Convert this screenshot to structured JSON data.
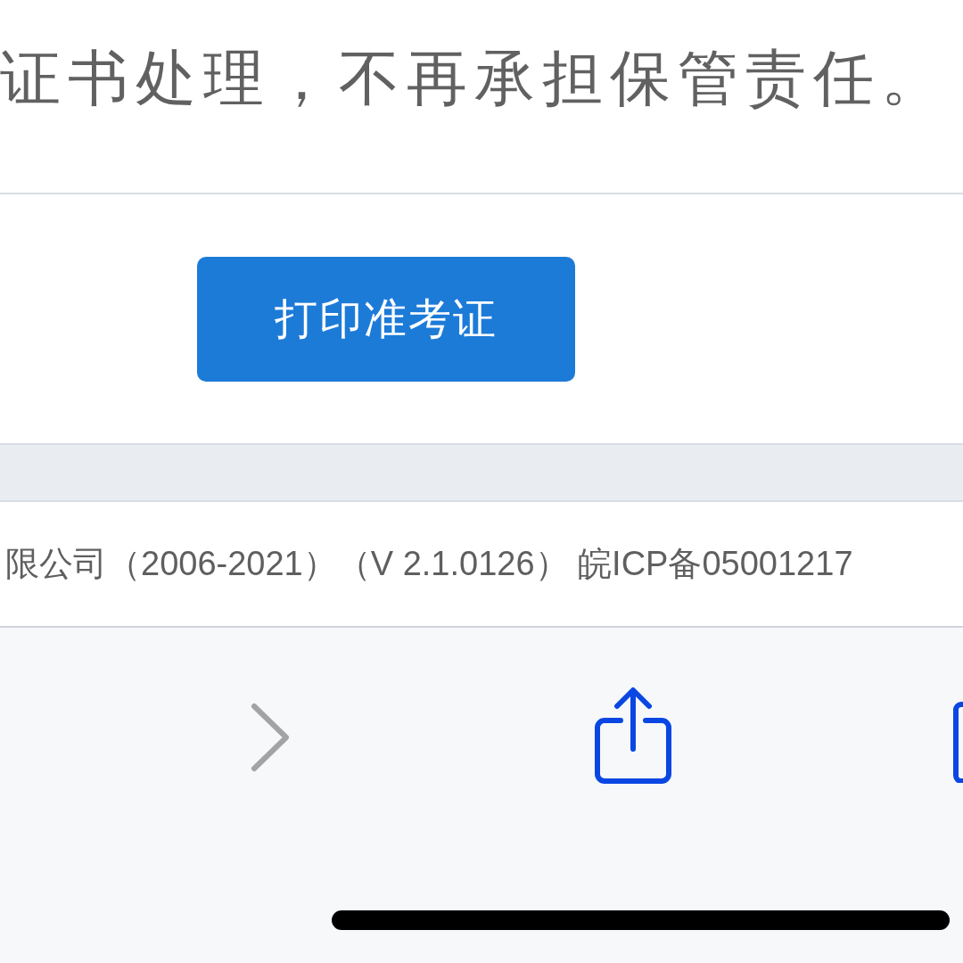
{
  "notice_text": "证书处理，不再承担保管责任。",
  "print_button": {
    "label": "打印准考证"
  },
  "footer_text": "限公司（2006-2021）（V 2.1.0126） 皖ICP备05001217",
  "toolbar": {
    "forward_disabled": true
  }
}
